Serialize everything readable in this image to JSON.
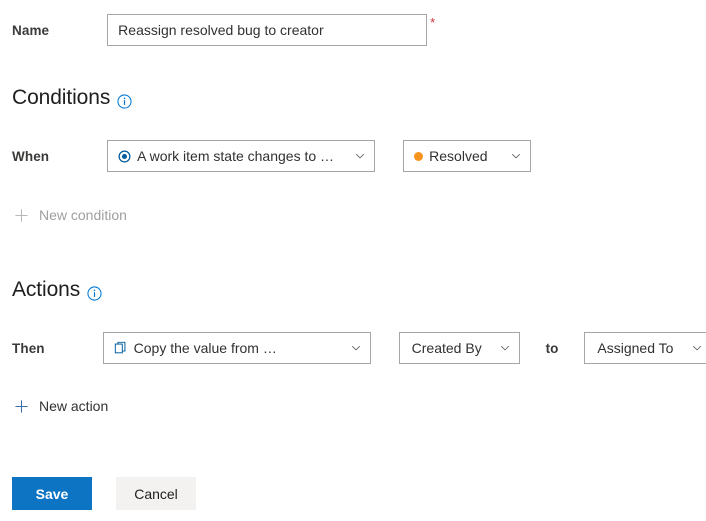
{
  "form": {
    "name_field": {
      "label": "Name",
      "value": "Reassign resolved bug to creator",
      "placeholder": "",
      "required_marker": "*"
    }
  },
  "conditions": {
    "heading": "Conditions",
    "info_icon": "info-icon",
    "when_label": "When",
    "trigger_dropdown": {
      "icon": "radio-target-icon",
      "value": "A work item state changes to …",
      "chevron": "chevron-down-icon"
    },
    "state_dropdown": {
      "icon": "state-dot-icon",
      "dot_color": "#f7941d",
      "value": "Resolved",
      "chevron": "chevron-down-icon"
    },
    "new_condition": {
      "icon": "plus-icon",
      "label": "New condition",
      "disabled": true
    }
  },
  "actions": {
    "heading": "Actions",
    "info_icon": "info-icon",
    "then_label": "Then",
    "action_dropdown": {
      "icon": "copy-icon",
      "value": "Copy the value from …",
      "chevron": "chevron-down-icon"
    },
    "source_dropdown": {
      "value": "Created By",
      "chevron": "chevron-down-icon"
    },
    "connector_label": "to",
    "target_dropdown": {
      "value": "Assigned To",
      "chevron": "chevron-down-icon"
    },
    "new_action": {
      "icon": "plus-icon",
      "label": "New action",
      "disabled": false
    }
  },
  "footer": {
    "save_label": "Save",
    "cancel_label": "Cancel"
  },
  "colors": {
    "accent": "#0078d4",
    "primary_button": "#0d74c4",
    "required_red": "#d13438",
    "resolved_orange": "#f7941d",
    "border": "#a6a6a6",
    "disabled_text": "#a19f9d"
  }
}
